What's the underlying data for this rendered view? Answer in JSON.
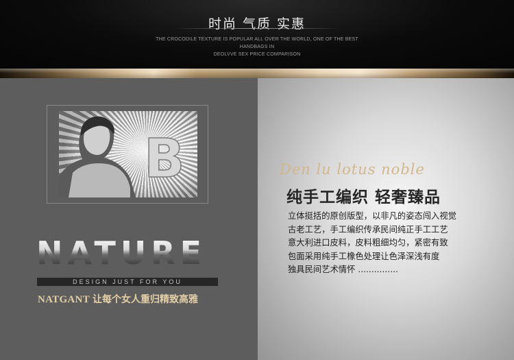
{
  "header": {
    "title": "时尚 气质 实惠",
    "subtitle_lines": [
      "THE CROCODILE TEXTURE IS POPULAR ALL OVER THE WORLD, ONE OF THE BEST",
      "HANDBAGS IN",
      "DEOLVVE SEX PRICE COMPARISON"
    ]
  },
  "left_panel": {
    "nature": "NATURE",
    "design": "DESIGN JUST FOR YOU",
    "brand": "NATGANT",
    "slogan": "让每个女人重归精致高雅",
    "photo_letter": "B"
  },
  "right_panel": {
    "script": "Den lu lotus noble",
    "heading": "纯手工编织  轻奢臻品",
    "body_lines": [
      "立体挺括的原创版型，以非凡的姿态闯入视觉",
      "古老工艺，手工编织传承民间纯正手工工艺",
      "意大利进口皮料，皮料粗细均匀，紧密有致",
      "包面采用纯手工橡色处理让色泽深浅有度",
      "独具民间艺术情怀 ..............."
    ]
  },
  "colors": {
    "gold": "#d2b68c",
    "dark": "#0b0b0b",
    "panel_left": "#5d5d5d"
  }
}
